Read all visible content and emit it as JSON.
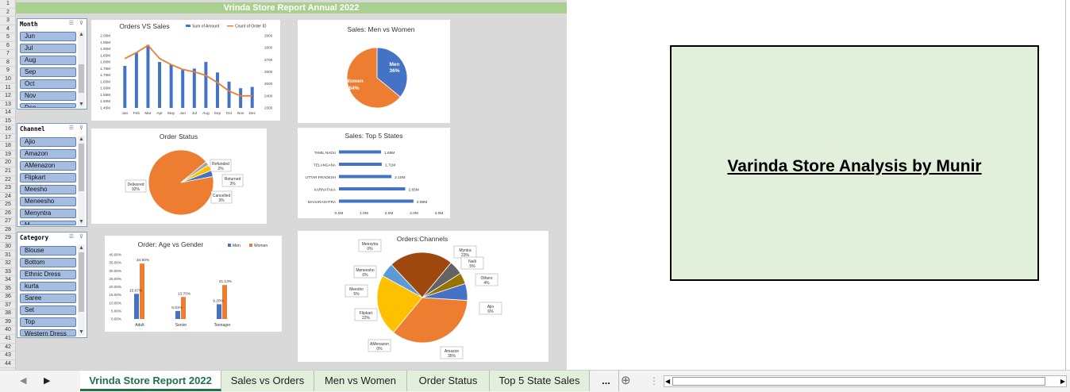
{
  "dashboard_title": "Vrinda Store Report Annual 2022",
  "row_numbers": [
    "1",
    "2",
    "3",
    "4",
    "5",
    "6",
    "7",
    "8",
    "9",
    "10",
    "11",
    "12",
    "13",
    "14",
    "15",
    "16",
    "17",
    "18",
    "19",
    "20",
    "21",
    "22",
    "23",
    "24",
    "25",
    "26",
    "27",
    "28",
    "29",
    "30",
    "31",
    "32",
    "33",
    "34",
    "35",
    "36",
    "37",
    "38",
    "39",
    "40",
    "41",
    "42",
    "43",
    "44"
  ],
  "slicers": {
    "month": {
      "title": "Month",
      "items": [
        "Jun",
        "Jul",
        "Aug",
        "Sep",
        "Oct",
        "Nov",
        "Dec"
      ]
    },
    "channel": {
      "title": "Channel",
      "items": [
        "Ajio",
        "Amazon",
        "AMenazon",
        "Flipkart",
        "Meesho",
        "Meneesho",
        "Menyntra",
        "M"
      ]
    },
    "category": {
      "title": "Category",
      "items": [
        "Blouse",
        "Bottom",
        "Ethnic Dress",
        "kurta",
        "Saree",
        "Set",
        "Top",
        "Western Dress"
      ]
    }
  },
  "charts": {
    "orders_sales": {
      "title": "Orders VS Sales",
      "legend": [
        "Sum of Amount",
        "Count of Order ID"
      ],
      "months": [
        "Jan",
        "Feb",
        "Mar",
        "Apr",
        "May",
        "Jun",
        "Jul",
        "Aug",
        "Sep",
        "Oct",
        "Nov",
        "Dec"
      ],
      "left_ticks": [
        "2.00M",
        "1.95M",
        "1.90M",
        "1.85M",
        "1.80M",
        "1.75M",
        "1.70M",
        "1.65M",
        "1.60M",
        "1.55M",
        "1.50M",
        "1.45M"
      ],
      "right_ticks": [
        "2900",
        "2800",
        "2700",
        "2600",
        "2500",
        "2400",
        "2300"
      ]
    },
    "men_women": {
      "title": "Sales: Men vs Women",
      "labels": [
        "Men",
        "Women"
      ],
      "pcts": [
        "36%",
        "64%"
      ]
    },
    "order_status": {
      "title": "Order Status",
      "labels": [
        "Delivered",
        "Refunded",
        "Returned",
        "Cancelled"
      ],
      "pcts": [
        "92%",
        "2%",
        "3%",
        "3%"
      ]
    },
    "top_states": {
      "title": "Sales: Top 5 States",
      "states": [
        "TAMIL NADU",
        "TELANGANA",
        "UTTAR PRADESH",
        "KARNATAKA",
        "MAHARASHTRA"
      ],
      "values": [
        "1.68M",
        "1.71M",
        "2.10M",
        "2.65M",
        "2.98M"
      ],
      "ticks": [
        "0.0M",
        "1.0M",
        "2.0M",
        "3.0M",
        "4.0M"
      ]
    },
    "age_gender": {
      "title": "Order: Age vs Gender",
      "legend": [
        "Men",
        "Women"
      ],
      "groups": [
        "Adult",
        "Senior",
        "Teenager"
      ],
      "men": [
        "15.67%",
        "5.01%",
        "9.20%"
      ],
      "women": [
        "34.50%",
        "13.70%",
        "21.13%"
      ],
      "ticks": [
        "40.00%",
        "35.00%",
        "30.00%",
        "25.00%",
        "20.00%",
        "15.00%",
        "10.00%",
        "5.00%",
        "0.00%"
      ]
    },
    "channels": {
      "title": "Orders:Channels",
      "labels": [
        "Myntra",
        "Nalli",
        "Others",
        "Ajio",
        "Amazon",
        "AMenazon",
        "Flipkart",
        "Meesho",
        "Meneesho",
        "Meesytra"
      ],
      "pcts": [
        "23%",
        "5%",
        "4%",
        "6%",
        "35%",
        "0%",
        "22%",
        "5%",
        "0%",
        "0%"
      ]
    }
  },
  "chart_data": [
    {
      "type": "bar",
      "title": "Orders VS Sales",
      "categories": [
        "Jan",
        "Feb",
        "Mar",
        "Apr",
        "May",
        "Jun",
        "Jul",
        "Aug",
        "Sep",
        "Oct",
        "Nov",
        "Dec"
      ],
      "series": [
        {
          "name": "Sum of Amount",
          "type": "bar",
          "axis": "left",
          "values": [
            1.77,
            1.87,
            1.93,
            1.8,
            1.78,
            1.74,
            1.75,
            1.8,
            1.72,
            1.65,
            1.6,
            1.61
          ]
        },
        {
          "name": "Count of Order ID",
          "type": "line",
          "axis": "right",
          "values": [
            2710,
            2760,
            2820,
            2710,
            2660,
            2620,
            2600,
            2570,
            2510,
            2440,
            2400,
            2400
          ]
        }
      ],
      "ylim_left": [
        1.45,
        2.0
      ],
      "ylim_right": [
        2300,
        2900
      ],
      "ylabel": "",
      "xlabel": ""
    },
    {
      "type": "pie",
      "title": "Sales: Men vs Women",
      "labels": [
        "Men",
        "Women"
      ],
      "values": [
        36,
        64
      ],
      "colors": [
        "#4472c4",
        "#ed7d31"
      ]
    },
    {
      "type": "pie",
      "title": "Order Status",
      "labels": [
        "Delivered",
        "Refunded",
        "Returned",
        "Cancelled"
      ],
      "values": [
        92,
        2,
        3,
        3
      ],
      "colors": [
        "#ed7d31",
        "#a5a5a5",
        "#ffc000",
        "#4472c4"
      ]
    },
    {
      "type": "bar",
      "orientation": "horizontal",
      "title": "Sales: Top 5 States",
      "categories": [
        "TAMIL NADU",
        "TELANGANA",
        "UTTAR PRADESH",
        "KARNATAKA",
        "MAHARASHTRA"
      ],
      "values": [
        1.68,
        1.71,
        2.1,
        2.65,
        2.98
      ],
      "xlim": [
        0,
        4
      ]
    },
    {
      "type": "bar",
      "title": "Order: Age vs Gender",
      "categories": [
        "Adult",
        "Senior",
        "Teenager"
      ],
      "series": [
        {
          "name": "Men",
          "values": [
            15.67,
            5.01,
            9.2
          ]
        },
        {
          "name": "Women",
          "values": [
            34.5,
            13.7,
            21.13
          ]
        }
      ],
      "ylim": [
        0,
        40
      ]
    },
    {
      "type": "pie",
      "title": "Orders:Channels",
      "labels": [
        "Amazon",
        "Flipkart",
        "Meesho",
        "Meneesho",
        "Myntra",
        "Nalli",
        "Others",
        "Ajio",
        "AMenazon",
        "Meesytra"
      ],
      "values": [
        35,
        22,
        5,
        0,
        23,
        5,
        4,
        6,
        0,
        0
      ],
      "colors": [
        "#ed7d31",
        "#ffc000",
        "#5b9bd5",
        "#70ad47",
        "#9e480e",
        "#636363",
        "#997300",
        "#4472c4",
        "#a5a5a5",
        "#264478"
      ]
    }
  ],
  "banner_text": "Varinda Store Analysis by Munir",
  "tabs": [
    "Vrinda Store Report 2022",
    "Sales vs Orders",
    "Men vs Women",
    "Order Status",
    "Top 5 State Sales",
    "..."
  ],
  "colors": {
    "accent": "#217346",
    "title_green": "#a9d08e",
    "blue": "#4472c4",
    "orange": "#ed7d31",
    "banner_bg": "#e2efda"
  }
}
